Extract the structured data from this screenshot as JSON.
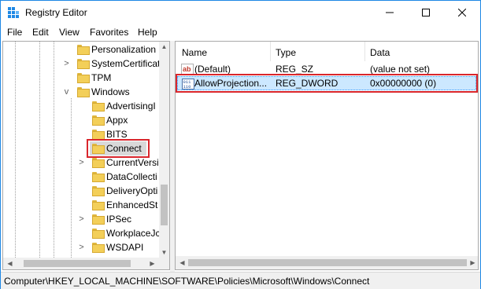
{
  "window": {
    "title": "Registry Editor"
  },
  "menu": [
    "File",
    "Edit",
    "View",
    "Favorites",
    "Help"
  ],
  "tree": {
    "nodes": [
      {
        "label": "Personalization",
        "expander": ""
      },
      {
        "label": "SystemCertificat",
        "expander": ">"
      },
      {
        "label": "TPM",
        "expander": ""
      },
      {
        "label": "Windows",
        "expander": "v"
      },
      {
        "label": "AdvertisingI",
        "expander": ""
      },
      {
        "label": "Appx",
        "expander": ""
      },
      {
        "label": "BITS",
        "expander": ""
      },
      {
        "label": "Connect",
        "expander": ""
      },
      {
        "label": "CurrentVersi",
        "expander": ">"
      },
      {
        "label": "DataCollecti",
        "expander": ""
      },
      {
        "label": "DeliveryOpti",
        "expander": ""
      },
      {
        "label": "EnhancedSt",
        "expander": ""
      },
      {
        "label": "IPSec",
        "expander": ">"
      },
      {
        "label": "WorkplaceJc",
        "expander": ""
      },
      {
        "label": "WSDAPI",
        "expander": ">"
      }
    ]
  },
  "list": {
    "columns": [
      "Name",
      "Type",
      "Data"
    ],
    "rows": [
      {
        "name": "(Default)",
        "type": "REG_SZ",
        "data": "(value not set)",
        "icon": "string-value-icon"
      },
      {
        "name": "AllowProjection...",
        "type": "REG_DWORD",
        "data": "0x00000000 (0)",
        "icon": "binary-value-icon"
      }
    ]
  },
  "status": {
    "path": "Computer\\HKEY_LOCAL_MACHINE\\SOFTWARE\\Policies\\Microsoft\\Windows\\Connect"
  },
  "colors": {
    "highlight": "#d9262c",
    "selection": "#cce8ff",
    "folder": "#f3cf59",
    "titlebar_border": "#1e88e5"
  }
}
